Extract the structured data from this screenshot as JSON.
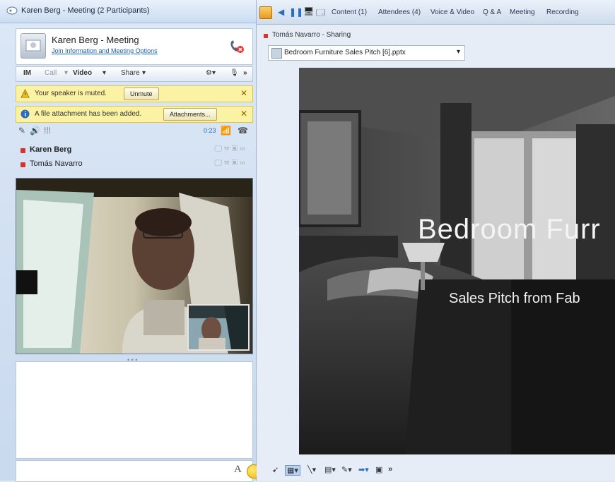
{
  "window": {
    "title": "Karen Berg - Meeting (2 Participants)"
  },
  "header": {
    "meeting_title": "Karen Berg - Meeting",
    "join_link": "Join Information and Meeting Options"
  },
  "modality_bar": {
    "im": "IM",
    "call": "Call",
    "video": "Video",
    "share": "Share",
    "more": "»"
  },
  "notifications": {
    "muted_text": "Your speaker is muted.",
    "unmute_label": "Unmute",
    "attachment_text": "A file attachment has been added.",
    "attachments_label": "Attachments..."
  },
  "roster": {
    "timer": "0:23",
    "participants": [
      {
        "name": "Karen Berg"
      },
      {
        "name": "Tomás Navarro"
      }
    ]
  },
  "stage": {
    "tabs": [
      "Content (1)",
      "Attendees (4)",
      "Voice & Video",
      "Q & A",
      "Meeting",
      "Recording"
    ],
    "sharing_label": "Tomás Navarro - Sharing",
    "file_name": "Bedroom Furniture Sales Pitch [6].pptx",
    "slide_title": "Bedroom Furr",
    "slide_subtitle": "Sales Pitch from Fab",
    "annot_more": "»"
  },
  "colors": {
    "notify_bg": "#fcf2a3",
    "link": "#1e63b6",
    "presence_busy": "#d9342b"
  }
}
